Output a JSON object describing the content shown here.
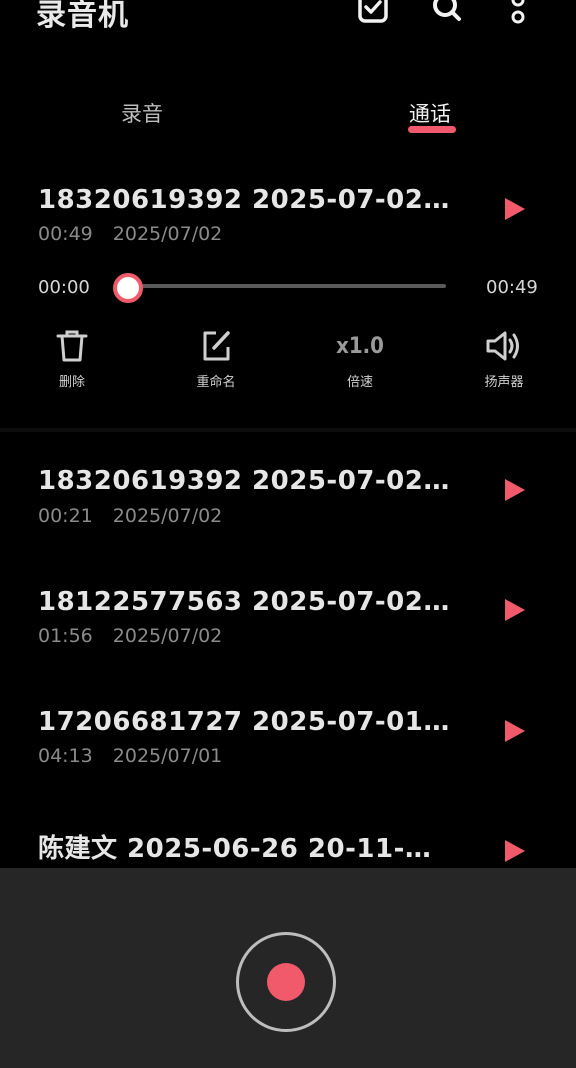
{
  "header": {
    "app_title": "录音机",
    "icons": [
      "checklist-icon",
      "search-icon",
      "more-vertical-icon"
    ]
  },
  "tabs": [
    {
      "label": "录音",
      "active": false
    },
    {
      "label": "通话",
      "active": true
    }
  ],
  "colors": {
    "accent": "#f05a6a",
    "background": "#000000",
    "bottom_bar": "#262626"
  },
  "expanded": {
    "title": "18320619392  2025-07-02…",
    "duration": "00:49",
    "date": "2025/07/02",
    "current_time": "00:00",
    "total_time": "00:49",
    "progress": 0,
    "tools": [
      {
        "label": "删除",
        "icon": "trash-icon"
      },
      {
        "label": "重命名",
        "icon": "edit-icon"
      },
      {
        "label": "倍速",
        "icon": "speed-icon",
        "icon_text": "x1.0"
      },
      {
        "label": "扬声器",
        "icon": "speaker-icon"
      }
    ]
  },
  "recordings": [
    {
      "title": "18320619392  2025-07-02…",
      "duration": "00:21",
      "date": "2025/07/02"
    },
    {
      "title": "18122577563  2025-07-02…",
      "duration": "01:56",
      "date": "2025/07/02"
    },
    {
      "title": "17206681727  2025-07-01…",
      "duration": "04:13",
      "date": "2025/07/01"
    },
    {
      "title": "陈建文  2025-06-26  20-11-…"
    }
  ]
}
